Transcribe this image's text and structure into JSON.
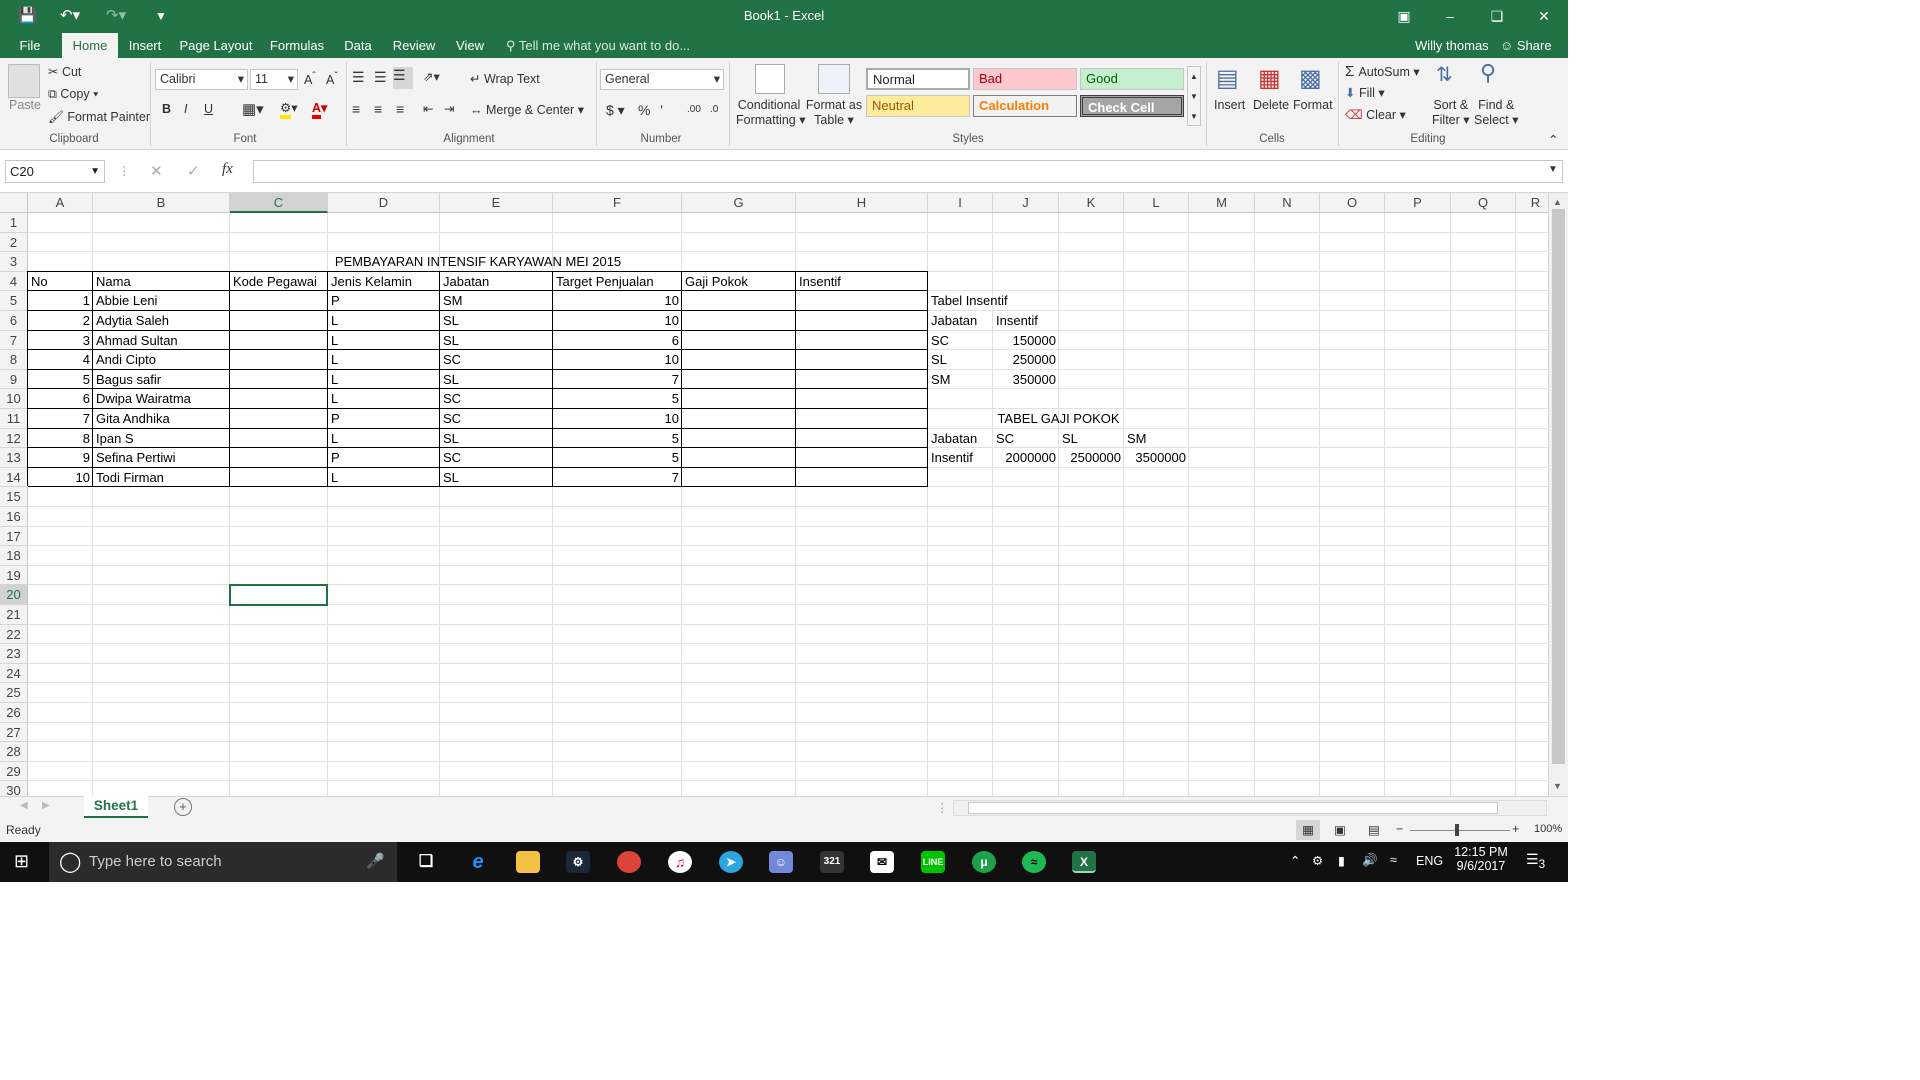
{
  "window": {
    "title": "Book1 - Excel",
    "user": "Willy thomas",
    "share": "Share"
  },
  "tabs": [
    "File",
    "Home",
    "Insert",
    "Page Layout",
    "Formulas",
    "Data",
    "Review",
    "View"
  ],
  "tell_me": "Tell me what you want to do...",
  "ribbon": {
    "clipboard": {
      "paste": "Paste",
      "cut": "Cut",
      "copy": "Copy",
      "format_painter": "Format Painter",
      "label": "Clipboard"
    },
    "font": {
      "name": "Calibri",
      "size": "11",
      "bold": "B",
      "italic": "I",
      "underline": "U",
      "label": "Font"
    },
    "alignment": {
      "wrap": "Wrap Text",
      "merge": "Merge & Center",
      "label": "Alignment"
    },
    "number": {
      "format": "General",
      "label": "Number"
    },
    "styles": {
      "conditional": "Conditional",
      "conditional2": "Formatting",
      "format_as": "Format as",
      "format_as2": "Table",
      "normal": "Normal",
      "bad": "Bad",
      "good": "Good",
      "neutral": "Neutral",
      "calculation": "Calculation",
      "check_cell": "Check Cell",
      "label": "Styles"
    },
    "cells": {
      "insert": "Insert",
      "delete": "Delete",
      "format": "Format",
      "label": "Cells"
    },
    "editing": {
      "autosum": "AutoSum",
      "fill": "Fill",
      "clear": "Clear",
      "sort": "Sort &",
      "sort2": "Filter",
      "find": "Find &",
      "find2": "Select",
      "label": "Editing"
    }
  },
  "name_box": "C20",
  "fx": "fx",
  "columns": [
    "A",
    "B",
    "C",
    "D",
    "E",
    "F",
    "G",
    "H",
    "I",
    "J",
    "K",
    "L",
    "M",
    "N",
    "O",
    "P",
    "Q",
    "R"
  ],
  "rows": [
    "1",
    "2",
    "3",
    "4",
    "5",
    "6",
    "7",
    "8",
    "9",
    "10",
    "11",
    "12",
    "13",
    "14",
    "15",
    "16",
    "17",
    "18",
    "19",
    "20",
    "21",
    "22",
    "23",
    "24",
    "25",
    "26",
    "27",
    "28",
    "29",
    "30"
  ],
  "sheet": {
    "title": "PEMBAYARAN INTENSIF KARYAWAN MEI 2015",
    "headers": [
      "No",
      "Nama",
      "Kode Pegawai",
      "Jenis Kelamin",
      "Jabatan",
      "Target Penjualan",
      "Gaji Pokok",
      "Insentif"
    ],
    "data": [
      [
        "1",
        "Abbie Leni",
        "",
        "P",
        "SM",
        "10"
      ],
      [
        "2",
        "Adytia Saleh",
        "",
        "L",
        "SL",
        "10"
      ],
      [
        "3",
        "Ahmad Sultan",
        "",
        "L",
        "SL",
        "6"
      ],
      [
        "4",
        "Andi Cipto",
        "",
        "L",
        "SC",
        "10"
      ],
      [
        "5",
        "Bagus safir",
        "",
        "L",
        "SL",
        "7"
      ],
      [
        "6",
        "Dwipa Wairatma",
        "",
        "L",
        "SC",
        "5"
      ],
      [
        "7",
        "Gita Andhika",
        "",
        "P",
        "SC",
        "10"
      ],
      [
        "8",
        "Ipan S",
        "",
        "L",
        "SL",
        "5"
      ],
      [
        "9",
        "Sefina Pertiwi",
        "",
        "P",
        "SC",
        "5"
      ],
      [
        "10",
        "Todi Firman",
        "",
        "L",
        "SL",
        "7"
      ]
    ],
    "tabel_insentif": {
      "title": "Tabel Insentif",
      "h1": "Jabatan",
      "h2": "Insentif",
      "rows": [
        [
          "SC",
          "150000"
        ],
        [
          "SL",
          "250000"
        ],
        [
          "SM",
          "350000"
        ]
      ]
    },
    "tabel_gaji": {
      "title": "TABEL GAJI POKOK",
      "r1": [
        "Jabatan",
        "SC",
        "SL",
        "SM"
      ],
      "r2": [
        "Insentif",
        "2000000",
        "2500000",
        "3500000"
      ]
    }
  },
  "sheet_tab": "Sheet1",
  "status": {
    "ready": "Ready",
    "zoom": "100%"
  },
  "taskbar": {
    "search": "Type here to search",
    "lang": "ENG",
    "time": "12:15 PM",
    "date": "9/6/2017",
    "notif": "3"
  }
}
